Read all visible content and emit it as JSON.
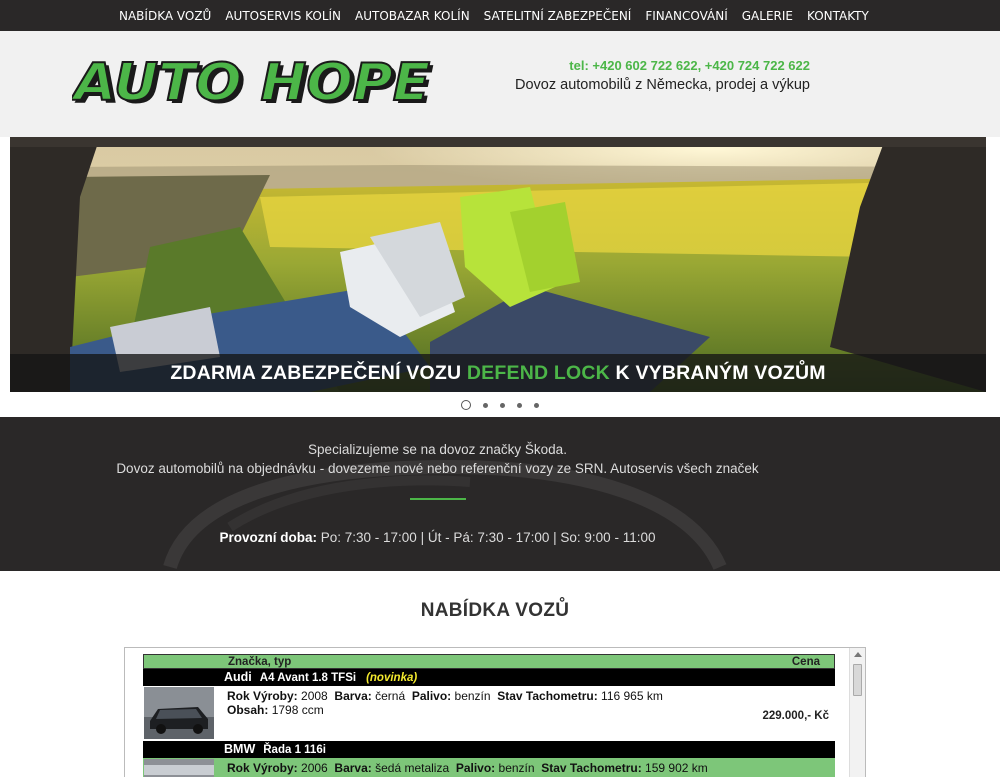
{
  "nav": {
    "items": [
      "NABÍDKA VOZŮ",
      "AUTOSERVIS KOLÍN",
      "AUTOBAZAR KOLÍN",
      "SATELITNÍ ZABEZPEČENÍ",
      "FINANCOVÁNÍ",
      "GALERIE",
      "KONTAKTY"
    ]
  },
  "header": {
    "logo_text": "AUTO HOPE",
    "phones": "tel: +420 602 722 622,  +420 724 722 622",
    "tagline": "Dovoz automobilů z Německa, prodej a výkup"
  },
  "slider": {
    "caption_before": "ZDARMA ZABEZPEČENÍ VOZU ",
    "caption_highlight": "DEFEND LOCK",
    "caption_after": " K VYBRANÝM VOZŮM",
    "total_slides": 5,
    "active_slide": 1
  },
  "info": {
    "line1": "Specializujeme se na dovoz značky Škoda.",
    "line2": "Dovoz automobilů na objednávku - dovezeme nové nebo referenční vozy ze SRN. Autoservis všech značek",
    "hours_label": "Provozní doba:",
    "hours_value": " Po: 7:30 - 17:00 | Út - Pá: 7:30 - 17:00 | So: 9:00 - 11:00"
  },
  "offers": {
    "title": "NABÍDKA VOZŮ",
    "col_make": "Značka, typ",
    "col_price": "Cena",
    "cars": [
      {
        "brand": "Audi",
        "model": "A4 Avant 1.8 TFSi",
        "badge": "(novinka)",
        "year_label": "Rok Výroby:",
        "year": "2008",
        "color_label": "Barva:",
        "color": "černá",
        "fuel_label": "Palivo:",
        "fuel": "benzín",
        "km_label": "Stav Tachometru:",
        "km": "116 965 km",
        "volume_label": "Obsah:",
        "volume": "1798 ccm",
        "price": "229.000,- Kč"
      },
      {
        "brand": "BMW",
        "model": "Řada 1 116i",
        "year_label": "Rok Výroby:",
        "year": "2006",
        "color_label": "Barva:",
        "color": "šedá metaliza",
        "fuel_label": "Palivo:",
        "fuel": "benzín",
        "km_label": "Stav Tachometru:",
        "km": "159 902 km"
      }
    ]
  },
  "colors": {
    "accent_green": "#4cb648",
    "table_green": "#7dc679",
    "dark_band": "#2a2828",
    "badge_yellow": "#f4ea2e"
  }
}
